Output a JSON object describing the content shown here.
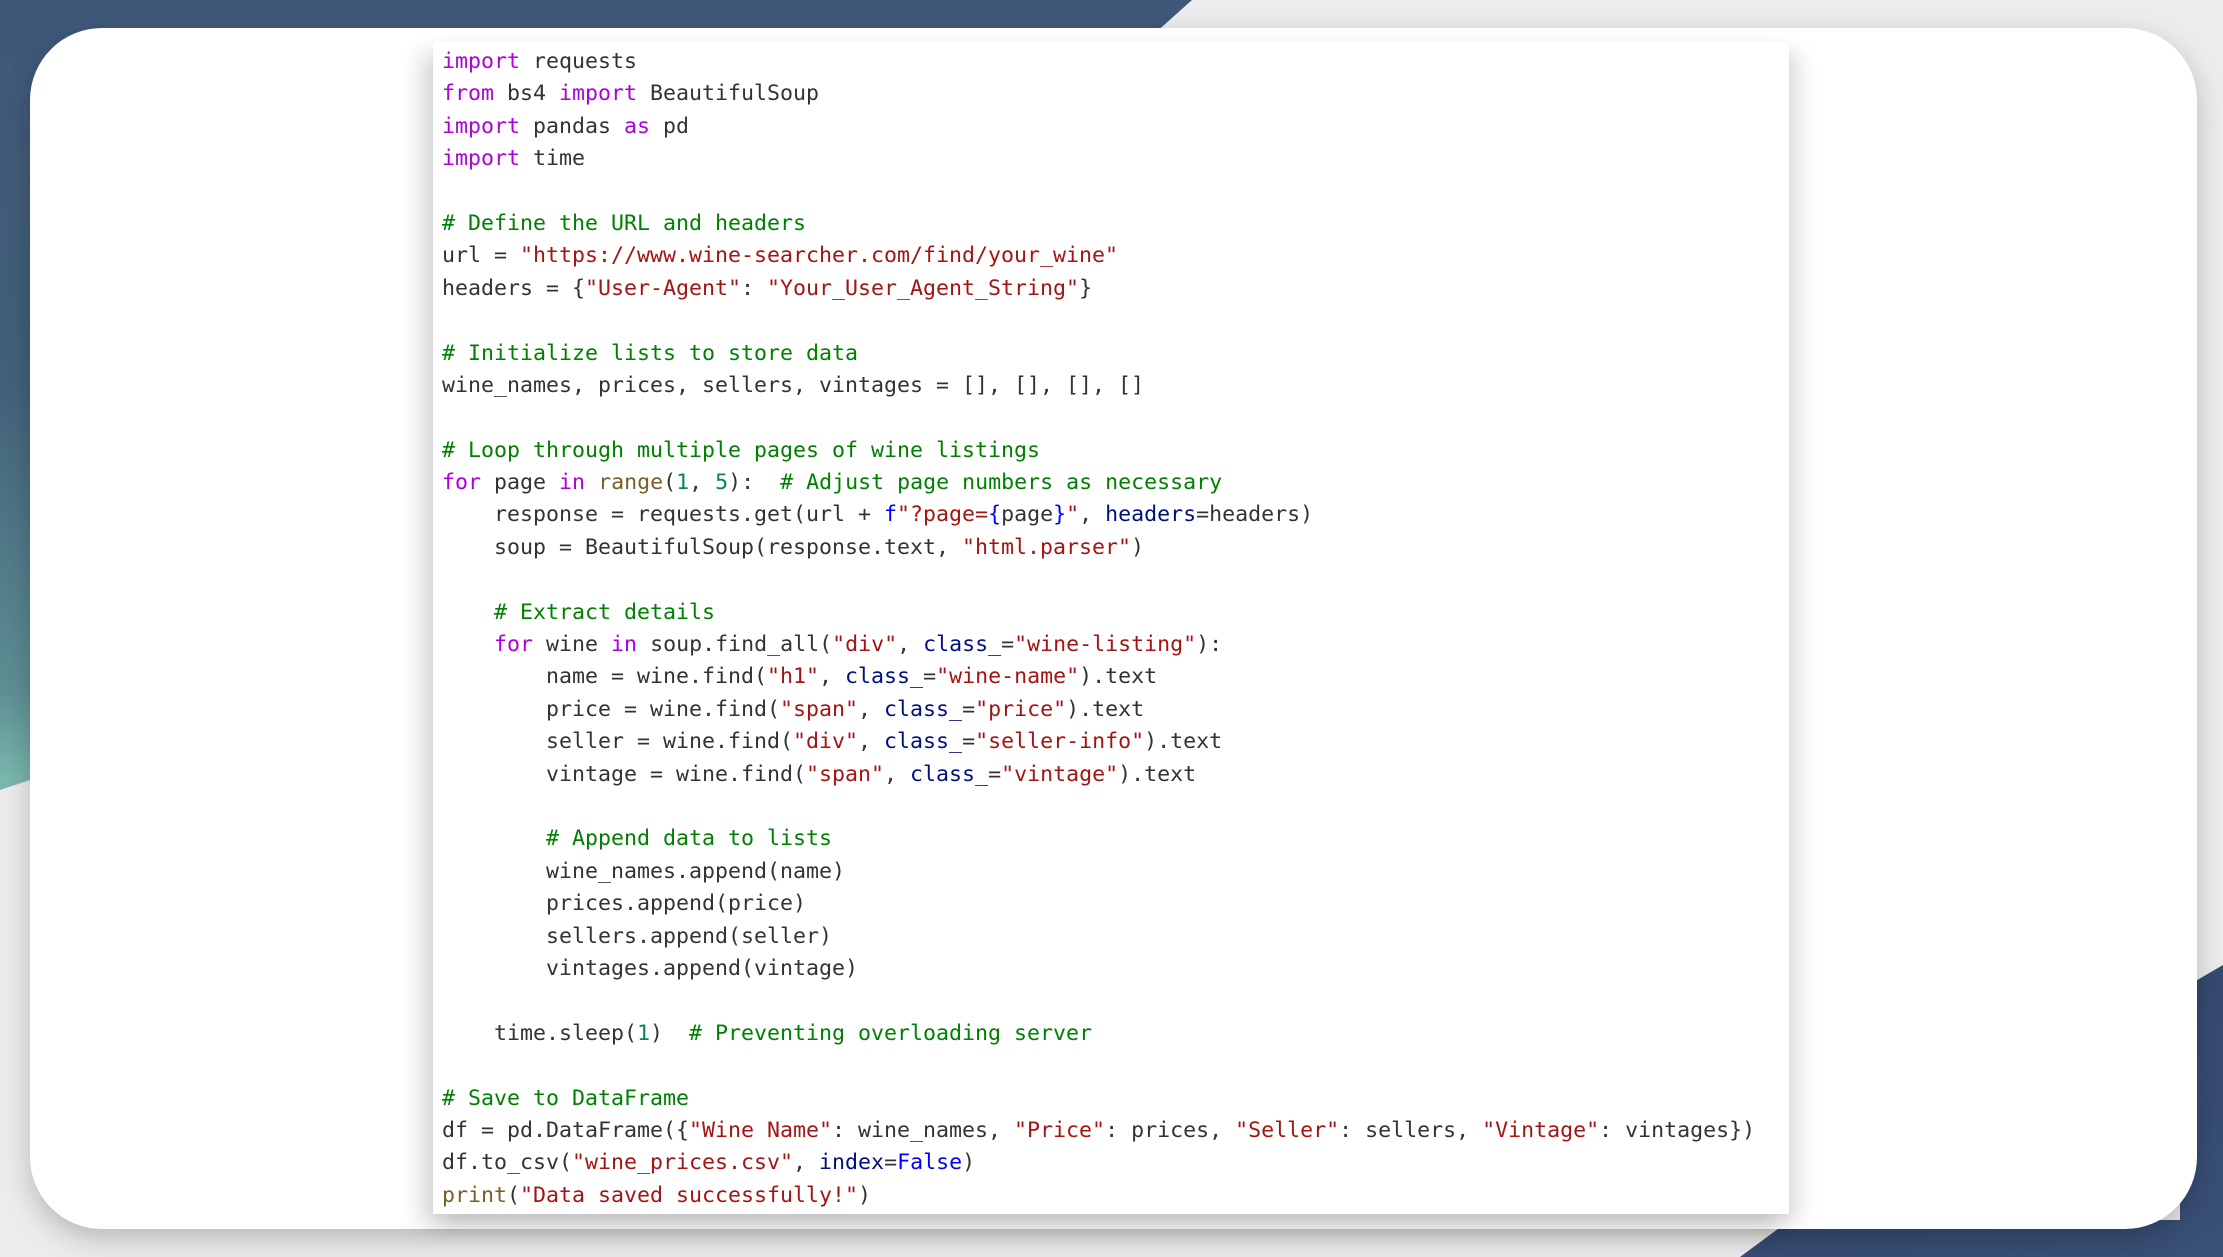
{
  "theme": {
    "keyword_color": "#af00db",
    "comment_color": "#008000",
    "string_color": "#a31515",
    "param_color": "#001080",
    "builtin_color": "#795e26",
    "number_color": "#098658",
    "constant_color": "#0000ff",
    "text_color": "#333333",
    "background_top": "#3f5879",
    "background_accent_teal": "#78b4ab",
    "background_bottom": "#2b3b63"
  },
  "code": {
    "language": "python",
    "lines": [
      [
        {
          "t": "kw",
          "v": "import"
        },
        {
          "t": "txt",
          "v": " requests"
        }
      ],
      [
        {
          "t": "kw",
          "v": "from"
        },
        {
          "t": "txt",
          "v": " bs4 "
        },
        {
          "t": "kw",
          "v": "import"
        },
        {
          "t": "txt",
          "v": " BeautifulSoup"
        }
      ],
      [
        {
          "t": "kw",
          "v": "import"
        },
        {
          "t": "txt",
          "v": " pandas "
        },
        {
          "t": "kw",
          "v": "as"
        },
        {
          "t": "txt",
          "v": " pd"
        }
      ],
      [
        {
          "t": "kw",
          "v": "import"
        },
        {
          "t": "txt",
          "v": " time"
        }
      ],
      [],
      [
        {
          "t": "cm",
          "v": "# Define the URL and headers"
        }
      ],
      [
        {
          "t": "txt",
          "v": "url = "
        },
        {
          "t": "str",
          "v": "\"https://www.wine-searcher.com/find/your_wine\""
        }
      ],
      [
        {
          "t": "txt",
          "v": "headers = {"
        },
        {
          "t": "str",
          "v": "\"User-Agent\""
        },
        {
          "t": "txt",
          "v": ": "
        },
        {
          "t": "str",
          "v": "\"Your_User_Agent_String\""
        },
        {
          "t": "txt",
          "v": "}"
        }
      ],
      [],
      [
        {
          "t": "cm",
          "v": "# Initialize lists to store data"
        }
      ],
      [
        {
          "t": "txt",
          "v": "wine_names, prices, sellers, vintages = [], [], [], []"
        }
      ],
      [],
      [
        {
          "t": "cm",
          "v": "# Loop through multiple pages of wine listings"
        }
      ],
      [
        {
          "t": "kw",
          "v": "for"
        },
        {
          "t": "txt",
          "v": " page "
        },
        {
          "t": "kw",
          "v": "in"
        },
        {
          "t": "txt",
          "v": " "
        },
        {
          "t": "fn",
          "v": "range"
        },
        {
          "t": "txt",
          "v": "("
        },
        {
          "t": "num",
          "v": "1"
        },
        {
          "t": "txt",
          "v": ", "
        },
        {
          "t": "num",
          "v": "5"
        },
        {
          "t": "txt",
          "v": "):  "
        },
        {
          "t": "cm",
          "v": "# Adjust page numbers as necessary"
        }
      ],
      [
        {
          "t": "txt",
          "v": "    response = requests.get(url + "
        },
        {
          "t": "fpre",
          "v": "f"
        },
        {
          "t": "str",
          "v": "\"?page="
        },
        {
          "t": "brace",
          "v": "{"
        },
        {
          "t": "txt",
          "v": "page"
        },
        {
          "t": "brace",
          "v": "}"
        },
        {
          "t": "str",
          "v": "\""
        },
        {
          "t": "txt",
          "v": ", "
        },
        {
          "t": "param",
          "v": "headers"
        },
        {
          "t": "txt",
          "v": "=headers)"
        }
      ],
      [
        {
          "t": "txt",
          "v": "    soup = BeautifulSoup(response.text, "
        },
        {
          "t": "str",
          "v": "\"html.parser\""
        },
        {
          "t": "txt",
          "v": ")"
        }
      ],
      [],
      [
        {
          "t": "txt",
          "v": "    "
        },
        {
          "t": "cm",
          "v": "# Extract details"
        }
      ],
      [
        {
          "t": "txt",
          "v": "    "
        },
        {
          "t": "kw",
          "v": "for"
        },
        {
          "t": "txt",
          "v": " wine "
        },
        {
          "t": "kw",
          "v": "in"
        },
        {
          "t": "txt",
          "v": " soup.find_all("
        },
        {
          "t": "str",
          "v": "\"div\""
        },
        {
          "t": "txt",
          "v": ", "
        },
        {
          "t": "param",
          "v": "class_"
        },
        {
          "t": "txt",
          "v": "="
        },
        {
          "t": "str",
          "v": "\"wine-listing\""
        },
        {
          "t": "txt",
          "v": "):"
        }
      ],
      [
        {
          "t": "txt",
          "v": "        name = wine.find("
        },
        {
          "t": "str",
          "v": "\"h1\""
        },
        {
          "t": "txt",
          "v": ", "
        },
        {
          "t": "param",
          "v": "class_"
        },
        {
          "t": "txt",
          "v": "="
        },
        {
          "t": "str",
          "v": "\"wine-name\""
        },
        {
          "t": "txt",
          "v": ").text"
        }
      ],
      [
        {
          "t": "txt",
          "v": "        price = wine.find("
        },
        {
          "t": "str",
          "v": "\"span\""
        },
        {
          "t": "txt",
          "v": ", "
        },
        {
          "t": "param",
          "v": "class_"
        },
        {
          "t": "txt",
          "v": "="
        },
        {
          "t": "str",
          "v": "\"price\""
        },
        {
          "t": "txt",
          "v": ").text"
        }
      ],
      [
        {
          "t": "txt",
          "v": "        seller = wine.find("
        },
        {
          "t": "str",
          "v": "\"div\""
        },
        {
          "t": "txt",
          "v": ", "
        },
        {
          "t": "param",
          "v": "class_"
        },
        {
          "t": "txt",
          "v": "="
        },
        {
          "t": "str",
          "v": "\"seller-info\""
        },
        {
          "t": "txt",
          "v": ").text"
        }
      ],
      [
        {
          "t": "txt",
          "v": "        vintage = wine.find("
        },
        {
          "t": "str",
          "v": "\"span\""
        },
        {
          "t": "txt",
          "v": ", "
        },
        {
          "t": "param",
          "v": "class_"
        },
        {
          "t": "txt",
          "v": "="
        },
        {
          "t": "str",
          "v": "\"vintage\""
        },
        {
          "t": "txt",
          "v": ").text"
        }
      ],
      [],
      [
        {
          "t": "txt",
          "v": "        "
        },
        {
          "t": "cm",
          "v": "# Append data to lists"
        }
      ],
      [
        {
          "t": "txt",
          "v": "        wine_names.append(name)"
        }
      ],
      [
        {
          "t": "txt",
          "v": "        prices.append(price)"
        }
      ],
      [
        {
          "t": "txt",
          "v": "        sellers.append(seller)"
        }
      ],
      [
        {
          "t": "txt",
          "v": "        vintages.append(vintage)"
        }
      ],
      [],
      [
        {
          "t": "txt",
          "v": "    time.sleep("
        },
        {
          "t": "num",
          "v": "1"
        },
        {
          "t": "txt",
          "v": ")  "
        },
        {
          "t": "cm",
          "v": "# Preventing overloading server"
        }
      ],
      [],
      [
        {
          "t": "cm",
          "v": "# Save to DataFrame"
        }
      ],
      [
        {
          "t": "txt",
          "v": "df = pd.DataFrame({"
        },
        {
          "t": "str",
          "v": "\"Wine Name\""
        },
        {
          "t": "txt",
          "v": ": wine_names, "
        },
        {
          "t": "str",
          "v": "\"Price\""
        },
        {
          "t": "txt",
          "v": ": prices, "
        },
        {
          "t": "str",
          "v": "\"Seller\""
        },
        {
          "t": "txt",
          "v": ": sellers, "
        },
        {
          "t": "str",
          "v": "\"Vintage\""
        },
        {
          "t": "txt",
          "v": ": vintages})"
        }
      ],
      [
        {
          "t": "txt",
          "v": "df.to_csv("
        },
        {
          "t": "str",
          "v": "\"wine_prices.csv\""
        },
        {
          "t": "txt",
          "v": ", "
        },
        {
          "t": "param",
          "v": "index"
        },
        {
          "t": "txt",
          "v": "="
        },
        {
          "t": "const",
          "v": "False"
        },
        {
          "t": "txt",
          "v": ")"
        }
      ],
      [
        {
          "t": "fn",
          "v": "print"
        },
        {
          "t": "txt",
          "v": "("
        },
        {
          "t": "str",
          "v": "\"Data saved successfully!\""
        },
        {
          "t": "txt",
          "v": ")"
        }
      ]
    ]
  }
}
